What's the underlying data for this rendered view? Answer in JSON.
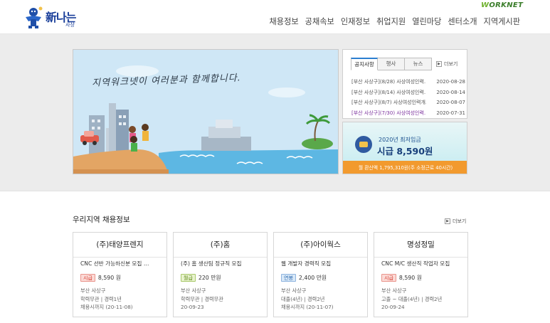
{
  "header": {
    "logo_main": "新나는",
    "logo_sub": "사상",
    "worknet_w": "W",
    "worknet_rest": "ORKNET",
    "nav": [
      "채용정보",
      "공채속보",
      "인재정보",
      "취업지원",
      "열린마당",
      "센터소개",
      "지역게시판"
    ]
  },
  "banner": {
    "text": "지역워크넷이 여러분과 함께합니다."
  },
  "notice": {
    "tabs": [
      "공지사항",
      "행사",
      "뉴스"
    ],
    "active_tab": 0,
    "more_label": "더보기",
    "items": [
      {
        "title": "[부산 사상구](8/28) 사상여성인력…",
        "date": "2020-08-28"
      },
      {
        "title": "[부산 사상구](8/14) 사상여성인력…",
        "date": "2020-08-14"
      },
      {
        "title": "[부산 사상구](8/7) 사상여성인력개…",
        "date": "2020-08-07"
      },
      {
        "title": "[부산 사상구](7/30) 사상여성인력…",
        "date": "2020-07-31"
      }
    ]
  },
  "wage": {
    "title": "2020년 최저임금",
    "amount": "시급 8,590원",
    "detail": "월 환산액 1,795,310원(주 소정근로 40시간)"
  },
  "jobs": {
    "section_title": "우리지역 채용정보",
    "more_label": "더보기",
    "cards": [
      {
        "company": "(주)태양프렌지",
        "job": "CNC 선반 가능하신분 모집 …",
        "pay_type": "시급",
        "pay": "8,590 원",
        "location": "부산 사상구",
        "req": "학력무관 | 경력1년",
        "deadline": "채용시까지 (20-11-08)"
      },
      {
        "company": "(주)홈",
        "job": "(주) 홈 생산팀 정규직 모집",
        "pay_type": "월급",
        "pay": "220 만원",
        "location": "부산 사상구",
        "req": "학력무관 | 경력무관",
        "deadline": "20-09-23"
      },
      {
        "company": "(주)아이웍스",
        "job": "웹 개발자 경력직 모집",
        "pay_type": "연봉",
        "pay": "2,400 만원",
        "location": "부산 사상구",
        "req": "대졸(4년) | 경력2년",
        "deadline": "채용시까지 (20-11-07)"
      },
      {
        "company": "명성정밀",
        "job": "CNC M/C 생산직 작업자 모집",
        "pay_type": "시급",
        "pay": "8,590 원",
        "location": "부산 사상구",
        "req": "고졸 ~ 대졸(4년) | 경력2년",
        "deadline": "20-09-24"
      }
    ]
  }
}
